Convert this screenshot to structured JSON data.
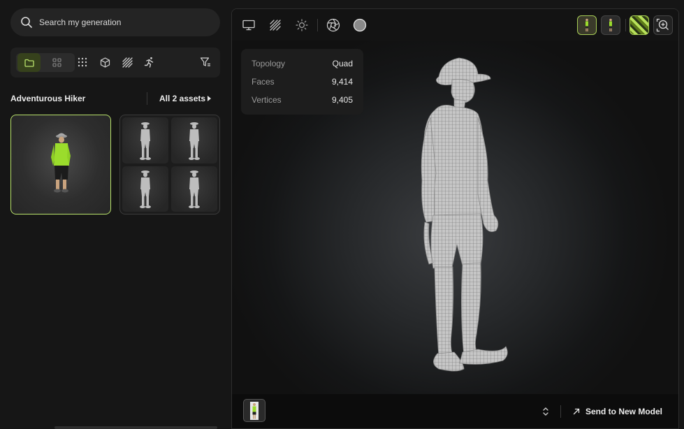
{
  "search": {
    "placeholder": "Search my generation"
  },
  "filters": {
    "view_modes": [
      "folder-icon",
      "grid-icon"
    ],
    "type_icons": [
      "dots-grid-icon",
      "cube-icon",
      "hatch-icon",
      "running-figure-icon"
    ],
    "filter_icon": "filter-icon"
  },
  "collection": {
    "name": "Adventurous Hiker",
    "all_assets_label": "All 2 assets"
  },
  "viewer": {
    "toolbar_icons": [
      "monitor-icon",
      "wireframe-hatch-icon",
      "light-icon",
      "aperture-icon",
      "sphere-icon"
    ],
    "stats": [
      {
        "label": "Topology",
        "value": "Quad"
      },
      {
        "label": "Faces",
        "value": "9,414"
      },
      {
        "label": "Vertices",
        "value": "9,405"
      }
    ],
    "footer": {
      "send_label": "Send to New Model"
    }
  },
  "colors": {
    "accent": "#b9e36b",
    "shirt": "#9bdc2c"
  }
}
